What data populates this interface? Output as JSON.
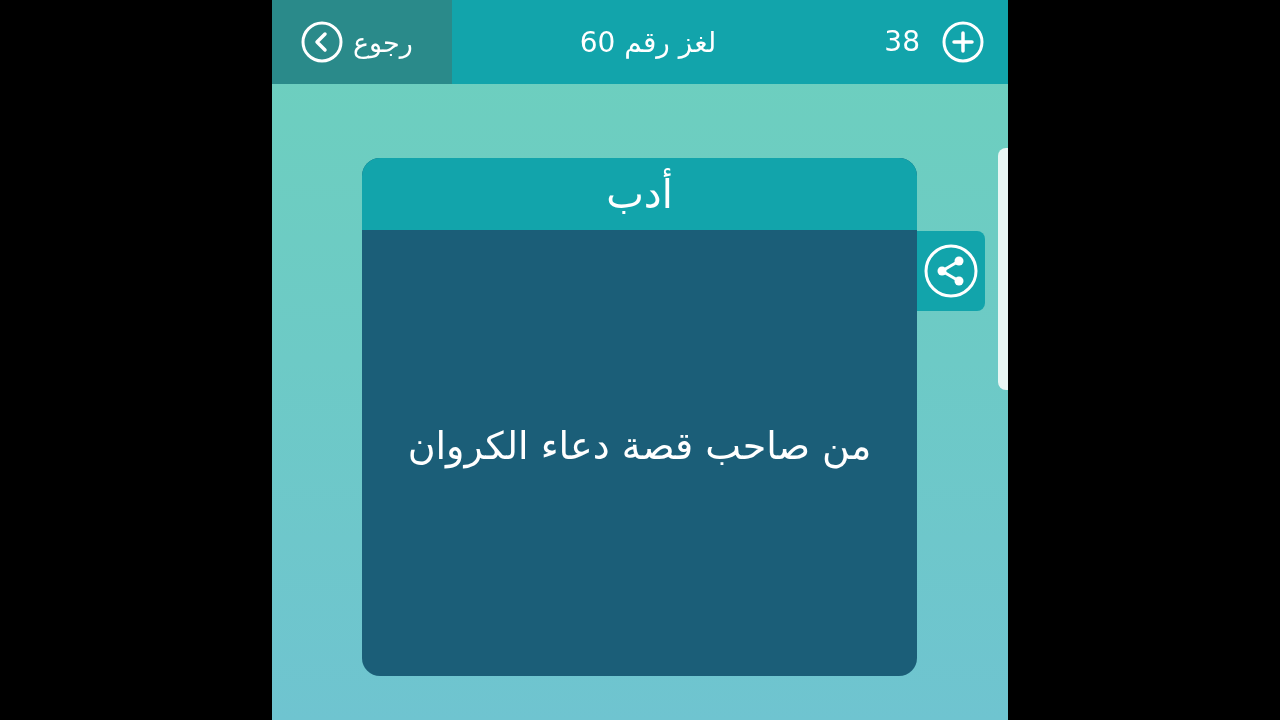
{
  "top_bar": {
    "back_button": {
      "label": "رجوع"
    },
    "title": "لغز رقم 60",
    "coins": "38"
  },
  "puzzle_card": {
    "category": "أدب",
    "question": "من صاحب قصة دعاء الكروان"
  }
}
